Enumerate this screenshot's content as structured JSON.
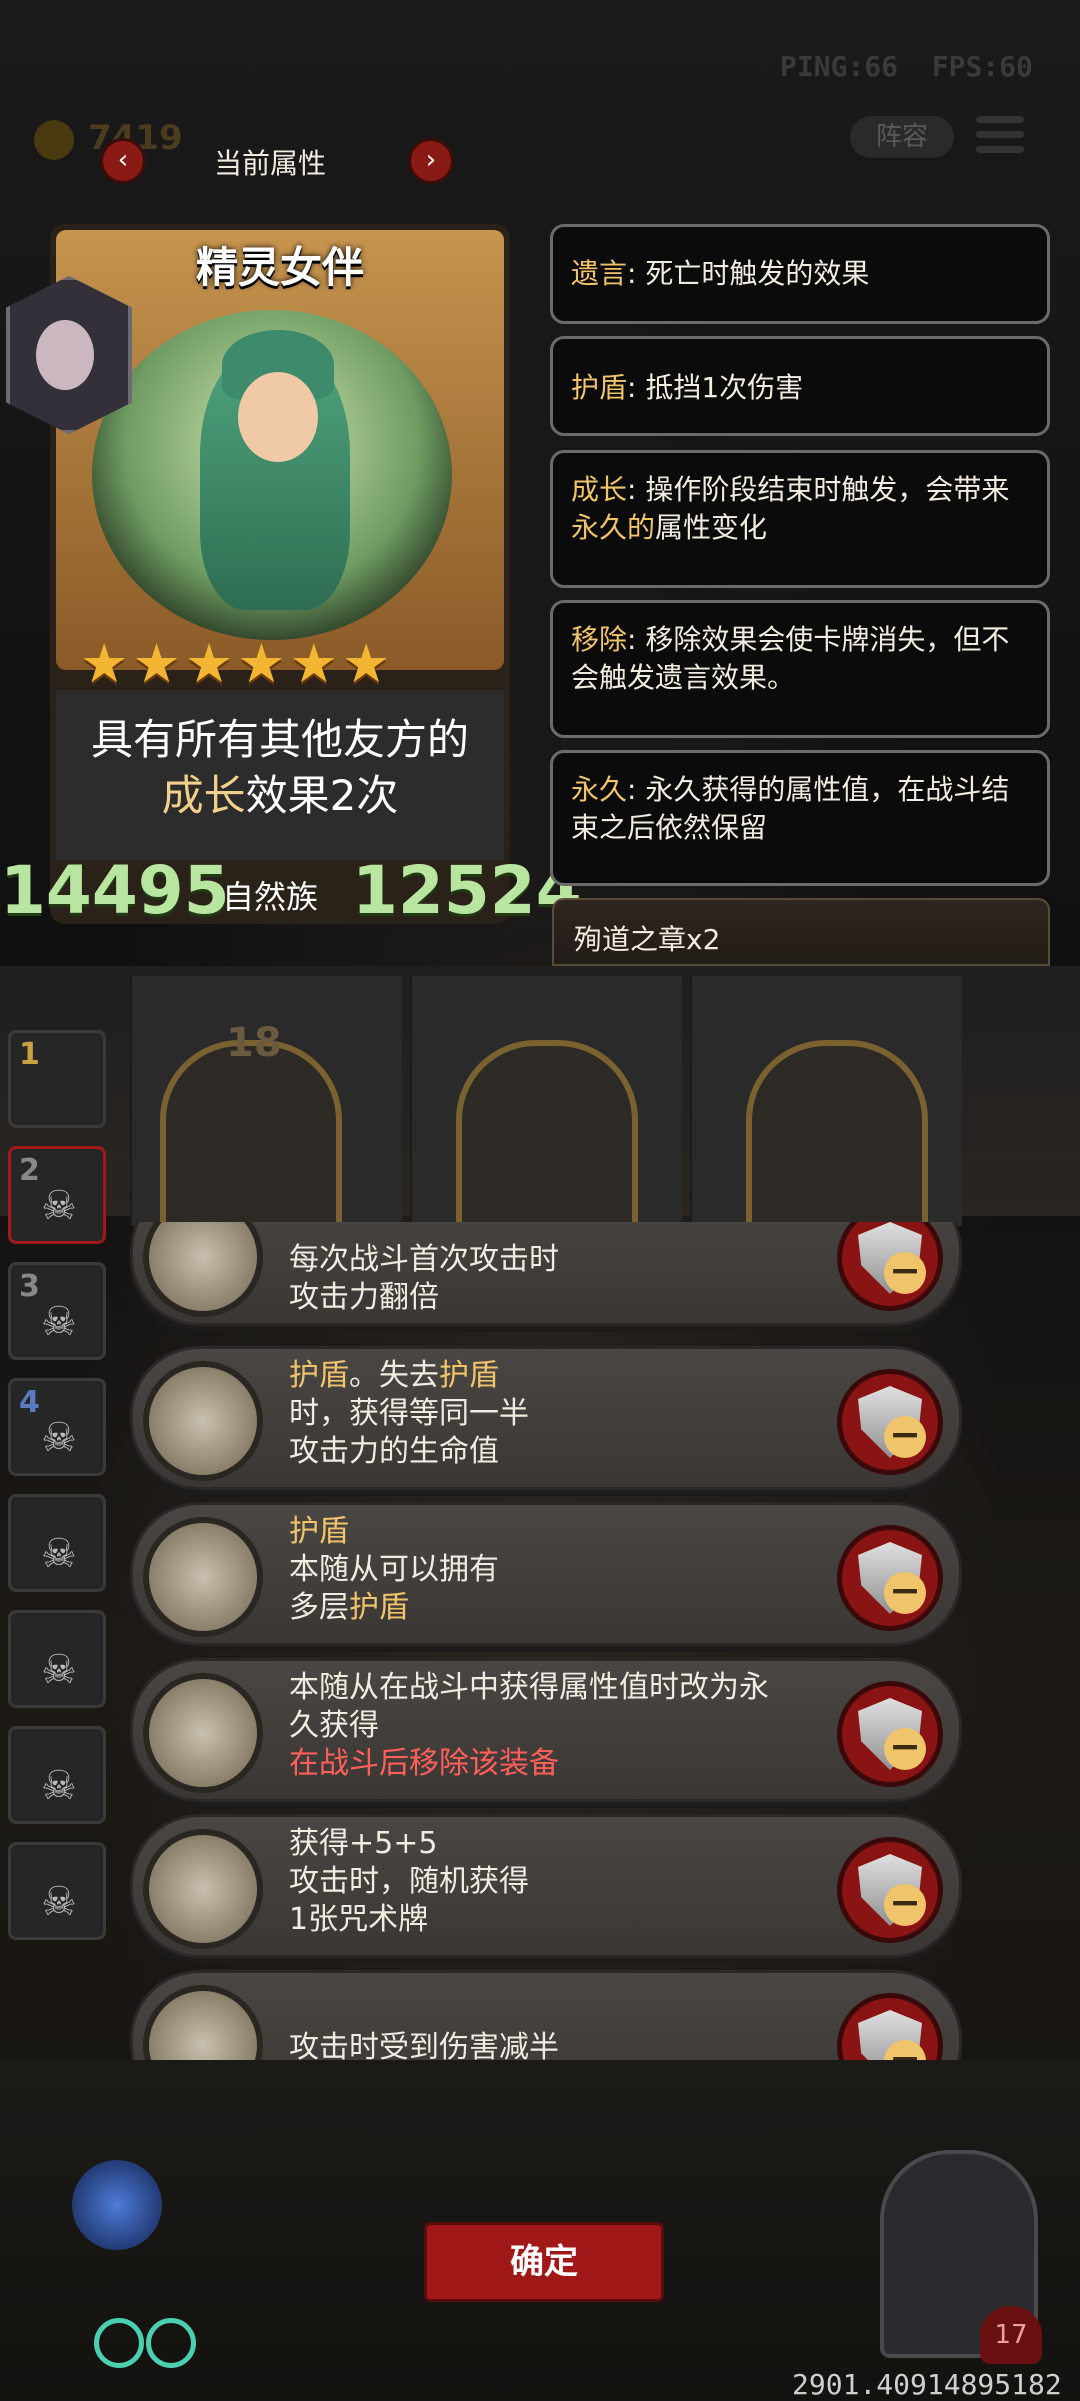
{
  "hud": {
    "ping": "PING:66",
    "fps": "FPS:60",
    "coins": "7419",
    "roster_label": "阵容"
  },
  "attribute_nav": {
    "title": "当前属性",
    "prev": "‹",
    "next": "›"
  },
  "card": {
    "name": "精灵女伴",
    "stars": "★★★★★★",
    "ability_line1": "具有所有其他友方的",
    "ability_hl": "成长",
    "ability_rest": "效果2次",
    "attack": "14495",
    "tribe": "自然族",
    "health": "12524"
  },
  "keywords": [
    {
      "name": "遗言",
      "desc": ": 死亡时触发的效果"
    },
    {
      "name": "护盾",
      "desc": ": 抵挡1次伤害"
    },
    {
      "name": "成长",
      "desc": ": 操作阶段结束时触发，会带来",
      "hl": "永久的",
      "tail": "属性变化"
    },
    {
      "name": "移除",
      "desc": ": 移除效果会使卡牌消失，但不会触发遗言效果。"
    },
    {
      "name": "永久",
      "desc": ": 永久获得的属性值，在战斗结束之后依然保留"
    }
  ],
  "relic": "殉道之章x2",
  "board": {
    "level": "18"
  },
  "roster": [
    "1",
    "2",
    "3",
    "4",
    "",
    "",
    "",
    ""
  ],
  "equipment": [
    {
      "lines": [
        "每次战斗首次攻击时",
        "攻击力翻倍"
      ]
    },
    {
      "gold1": "护盾",
      "t1": "。失去",
      "gold2": "护盾",
      "t2": "时，获得等同一半",
      "t3": "攻击力的生命值"
    },
    {
      "gold1": "护盾",
      "l2": "本随从可以拥有",
      "l3a": "多层",
      "l3b": "护盾"
    },
    {
      "l1": "本随从在战斗中获得属性值时改为永",
      "l2": "久获得",
      "red": "在战斗后移除该装备"
    },
    {
      "l1": "获得+5+5",
      "l2": "攻击时，随机获得",
      "l3": "1张咒术牌"
    },
    {
      "l1": "攻击时受到伤害减半"
    }
  ],
  "confirm_label": "确定",
  "coords": "2901.40914895182",
  "life": "17",
  "colors": {
    "accent_red": "#a01818",
    "keyword_gold": "#f0c46a",
    "stat_green": "#b8e6a0",
    "warn_red": "#ff5f5a"
  }
}
